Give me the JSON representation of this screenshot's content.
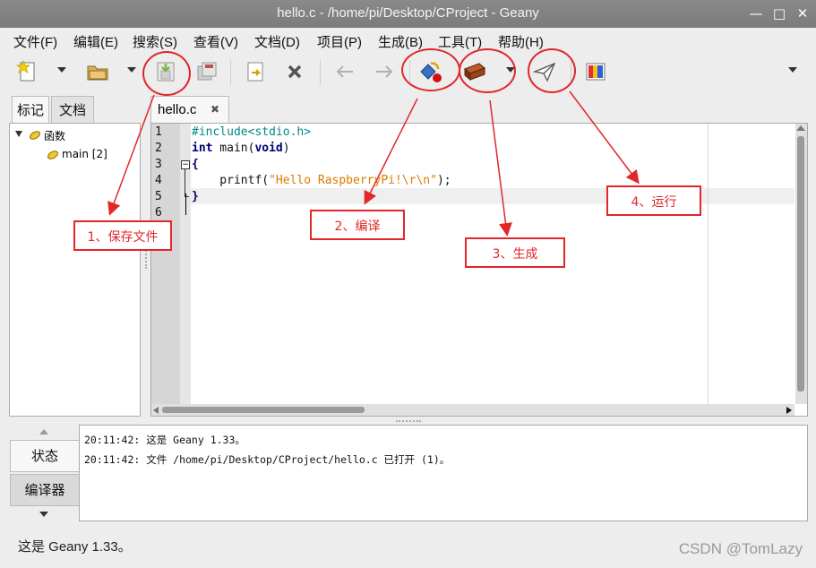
{
  "window": {
    "title": "hello.c - /home/pi/Desktop/CProject - Geany",
    "controls": [
      "—",
      "□",
      "✕"
    ]
  },
  "menubar": {
    "items": [
      "文件(F)",
      "编辑(E)",
      "搜索(S)",
      "查看(V)",
      "文档(D)",
      "项目(P)",
      "生成(B)",
      "工具(T)",
      "帮助(H)"
    ]
  },
  "toolbar": {
    "icons": [
      "new-file-icon",
      "open-folder-icon",
      "save-icon",
      "save-all-icon",
      "revert-icon",
      "close-file-icon",
      "back-arrow-icon",
      "forward-arrow-icon",
      "compile-icon",
      "build-brick-icon",
      "run-paper-plane-icon",
      "color-chooser-icon"
    ]
  },
  "sidebar": {
    "tabs": [
      "标记",
      "文档"
    ],
    "tree": {
      "group_label": "函数",
      "item_label": "main [2]"
    }
  },
  "editor": {
    "tab_label": "hello.c",
    "close_glyph": "✖",
    "line_numbers": [
      "1",
      "2",
      "3",
      "4",
      "5",
      "6"
    ],
    "lines": {
      "l1": "#include<stdio.h>",
      "l2_kw1": "int",
      "l2_rest": " main(",
      "l2_kw2": "void",
      "l2_end": ")",
      "l3": "{",
      "l4_pre": "    printf(",
      "l4_str": "\"Hello RaspberryPi!\\r\\n\"",
      "l4_end": ");",
      "l5": "}"
    }
  },
  "messages": {
    "tabs": [
      "状态",
      "编译器"
    ],
    "lines": [
      "20:11:42: 这是 Geany 1.33。",
      "20:11:42: 文件 /home/pi/Desktop/CProject/hello.c 已打开 (1)。"
    ]
  },
  "statusbar": {
    "text": "这是 Geany 1.33。"
  },
  "annotations": {
    "save": "1、保存文件",
    "compile": "2、编译",
    "build": "3、生成",
    "run": "4、运行"
  },
  "watermark": "CSDN @TomLazy",
  "colors": {
    "annotation_red": "#e2262a",
    "preprocessor": "#008a8a",
    "string": "#e07a00",
    "keyword": "#00007a"
  }
}
